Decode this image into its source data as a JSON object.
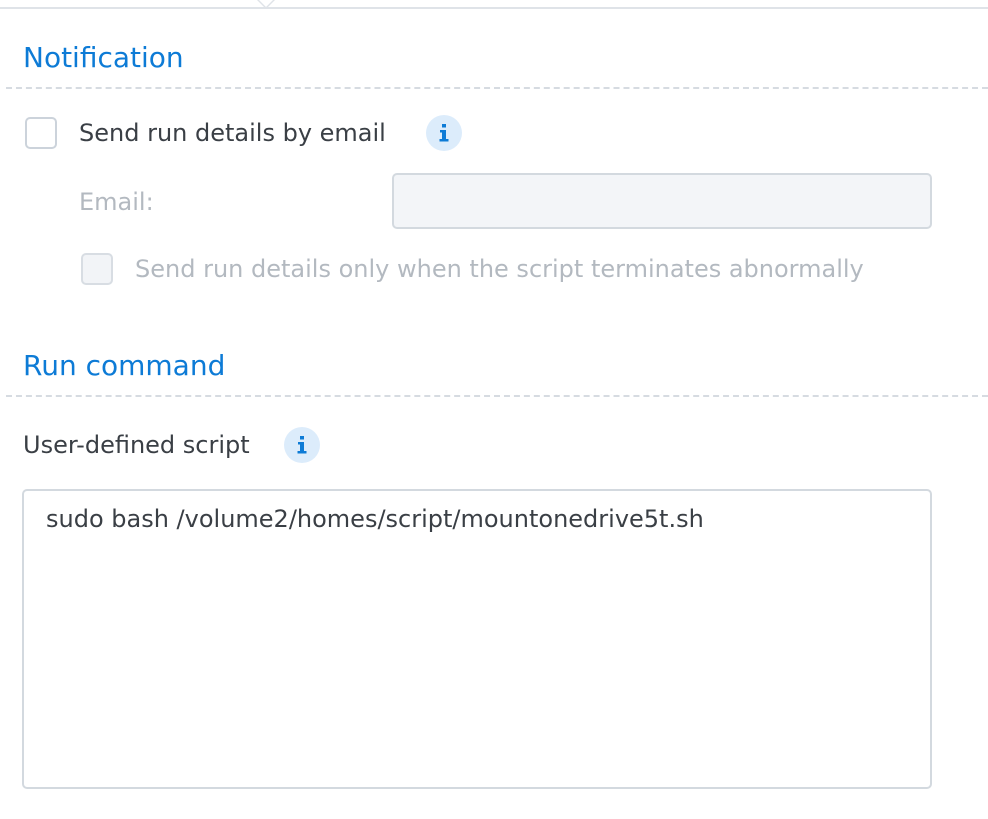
{
  "notification": {
    "title": "Notification",
    "send_email_label": "Send run details by email",
    "send_email_checked": false,
    "email_label": "Email:",
    "email_value": "",
    "abnormal_only_label": "Send run details only when the script terminates abnormally",
    "abnormal_only_checked": false
  },
  "run_command": {
    "title": "Run command",
    "script_label": "User-defined script",
    "script_value": "sudo bash /volume2/homes/script/mountonedrive5t.sh"
  },
  "colors": {
    "accent": "#0d7bd6",
    "text": "#3a3f45",
    "disabled_text": "#b3b9c0",
    "info_bg": "#dcecfb"
  }
}
